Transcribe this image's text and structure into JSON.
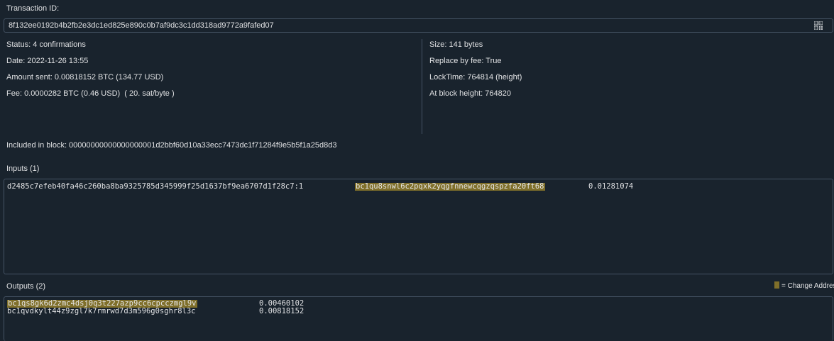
{
  "header": {
    "txid_label": "Transaction ID:",
    "txid": "8f132ee0192b4b2fb2e3dc1ed825e890c0b7af9dc3c1dd318ad9772a9fafed07",
    "qr_icon": "qrcode-icon"
  },
  "details_left": {
    "status": "Status: 4 confirmations",
    "date": "Date: 2022-11-26 13:55",
    "amount_sent": "Amount sent: 0.00818152 BTC (134.77 USD)",
    "fee": "Fee: 0.0000282 BTC (0.46 USD)  ( 20. sat/byte )"
  },
  "details_right": {
    "size": "Size: 141 bytes",
    "rbf": "Replace by fee: True",
    "locktime": "LockTime: 764814 (height)",
    "block_height": "At block height: 764820"
  },
  "included_in_block": "Included in block: 00000000000000000001d2bbf60d10a33ecc7473dc1f71284f9e5b5f1a25d8d3",
  "inputs": {
    "title": "Inputs (1)",
    "rows": [
      {
        "prevout": "d2485c7efeb40fa46c260ba8ba9325785d345999f25d1637bf9ea6707d1f28c7:1",
        "address": "bc1qu8snwl6c2pqxk2yqgfnnewcqgzqspzfa20ft68",
        "amount": "0.01281074",
        "is_change": true
      }
    ]
  },
  "outputs": {
    "title": "Outputs (2)",
    "rows": [
      {
        "address": "bc1qs8gk6d2zmc4dsj0q3t227azp9cc6cpcczmgl9v",
        "amount": "0.00460102",
        "is_change": true
      },
      {
        "address": "bc1qvdkylt44z9zgl7k7rmrwd7d3m596g0sghr8l3c",
        "amount": "0.00818152",
        "is_change": false
      }
    ]
  },
  "legend": {
    "change_label": "= Change Address"
  },
  "colors": {
    "background": "#19232d",
    "border": "#455364",
    "text": "#e0e1e3",
    "change_highlight": "#7f6f2a"
  }
}
